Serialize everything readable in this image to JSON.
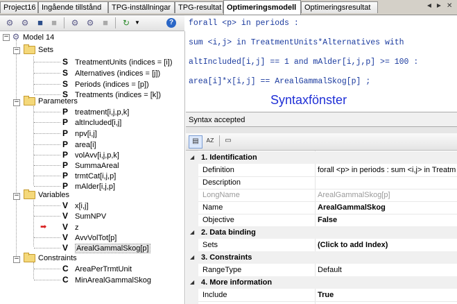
{
  "tabs": [
    {
      "label": "Project16"
    },
    {
      "label": "Ingående tillstånd"
    },
    {
      "label": "TPG-inställningar"
    },
    {
      "label": "TPG-resultat"
    },
    {
      "label": "Optimeringsmodell"
    },
    {
      "label": "Optimeringsresultat"
    }
  ],
  "tab_controls": {
    "prev": "◄",
    "next": "►",
    "close": "✕"
  },
  "toolbar_icons": [
    "gear-icon",
    "gear-icon",
    "save-icon",
    "save-icon",
    "gear-icon",
    "gear-icon",
    "save-icon",
    "refresh-icon",
    "help-icon"
  ],
  "toolbar_help": "?",
  "tree": {
    "root": "Model 14",
    "sets_label": "Sets",
    "sets": [
      "TreatmentUnits (indices = [i])",
      "Alternatives (indices = [j])",
      "Periods (indices = [p])",
      "Treatments (indices = [k])"
    ],
    "sets_letter": "S",
    "parameters_label": "Parameters",
    "parameters": [
      "treatment[i,j,p,k]",
      "altIncluded[i,j]",
      "npv[i,j]",
      "area[i]",
      "volAvv[i,j,p,k]",
      "SummaAreal",
      "trmtCat[i,j,p]",
      "mAlder[i,j,p]"
    ],
    "parameters_letter": "P",
    "variables_label": "Variables",
    "variables": [
      "x[i,j]",
      "SumNPV",
      "z",
      "AvvVolTot[p]",
      "ArealGammalSkog[p]"
    ],
    "variables_letter": "V",
    "constraints_label": "Constraints",
    "constraints": [
      "AreaPerTrmtUnit",
      "MinArealGammalSkog"
    ],
    "constraints_letter": "C"
  },
  "editor": {
    "lines": [
      "forall <p> in periods :",
      "sum <i,j> in TreatmentUnits*Alternatives with",
      "altIncluded[i,j] == 1 and mAlder[i,j,p] >= 100 :",
      "area[i]*x[i,j] == ArealGammalSkog[p] ;"
    ],
    "overlay_label": "Syntaxfönster"
  },
  "status": "Syntax accepted",
  "property_toolbar": {
    "categorized": "▤",
    "alpha": "AZ",
    "pages": "▭"
  },
  "properties": {
    "cat1": "1. Identification",
    "definition_name": "Definition",
    "definition_value": "forall <p> in periods : sum <i,j> in TreatmentUnits*Alternatives",
    "description_name": "Description",
    "description_value": "",
    "longname_name": "LongName",
    "longname_value": "ArealGammalSkog[p]",
    "name_name": "Name",
    "name_value": "ArealGammalSkog",
    "objective_name": "Objective",
    "objective_value": "False",
    "cat2": "2. Data binding",
    "sets_name": "Sets",
    "sets_value": "(Click to add Index)",
    "cat3": "3. Constraints",
    "rangetype_name": "RangeType",
    "rangetype_value": "Default",
    "cat4": "4. More information",
    "include_name": "Include",
    "include_value": "True",
    "collapse_glyph": "◢"
  },
  "colors": {
    "accent": "#1f2fd6",
    "code": "#1a3a9e",
    "arrow": "#d81e1e"
  }
}
